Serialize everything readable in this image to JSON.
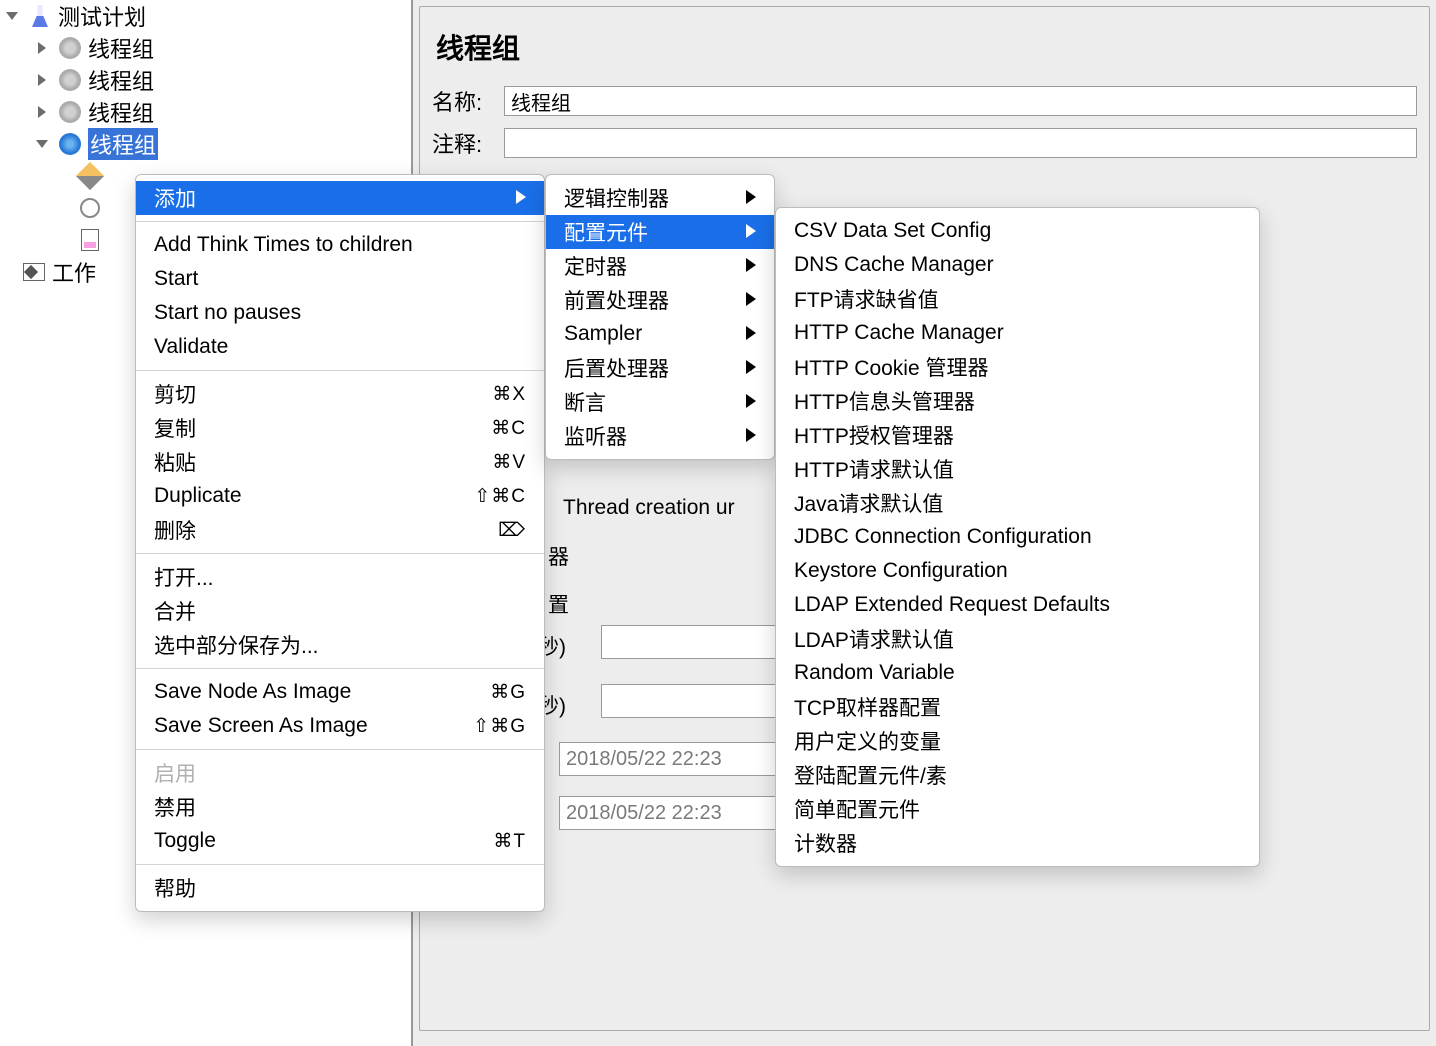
{
  "tree": {
    "root": "测试计划",
    "thread_groups": [
      "线程组",
      "线程组",
      "线程组",
      "线程组"
    ],
    "workbench": "工作"
  },
  "panel": {
    "title": "线程组",
    "name_label": "名称:",
    "name_value": "线程组",
    "comment_label": "注释:",
    "thread_creation_text": "Thread creation ur",
    "qi_text": "器",
    "zhi_text": "置",
    "sec1": "(秒)",
    "sec2": "(秒)",
    "date1": "2018/05/22 22:23",
    "date2": "2018/05/22 22:23"
  },
  "menu1": {
    "add": "添加",
    "think": "Add Think Times to children",
    "start": "Start",
    "start_np": "Start no pauses",
    "validate": "Validate",
    "cut": "剪切",
    "cut_sc": "⌘X",
    "copy": "复制",
    "copy_sc": "⌘C",
    "paste": "粘贴",
    "paste_sc": "⌘V",
    "dup": "Duplicate",
    "dup_sc": "⇧⌘C",
    "del": "删除",
    "del_sc": "⌦",
    "open": "打开...",
    "merge": "合并",
    "save_sel": "选中部分保存为...",
    "save_node": "Save Node As Image",
    "save_node_sc": "⌘G",
    "save_screen": "Save Screen As Image",
    "save_screen_sc": "⇧⌘G",
    "enable": "启用",
    "disable": "禁用",
    "toggle": "Toggle",
    "toggle_sc": "⌘T",
    "help": "帮助"
  },
  "menu2": {
    "logic": "逻辑控制器",
    "config": "配置元件",
    "timer": "定时器",
    "pre": "前置处理器",
    "sampler": "Sampler",
    "post": "后置处理器",
    "assert": "断言",
    "listen": "监听器"
  },
  "menu3": {
    "items": [
      "CSV Data Set Config",
      "DNS Cache Manager",
      "FTP请求缺省值",
      "HTTP Cache Manager",
      "HTTP Cookie 管理器",
      "HTTP信息头管理器",
      "HTTP授权管理器",
      "HTTP请求默认值",
      "Java请求默认值",
      "JDBC Connection Configuration",
      "Keystore Configuration",
      "LDAP Extended Request Defaults",
      "LDAP请求默认值",
      "Random Variable",
      "TCP取样器配置",
      "用户定义的变量",
      "登陆配置元件/素",
      "简单配置元件",
      "计数器"
    ]
  }
}
